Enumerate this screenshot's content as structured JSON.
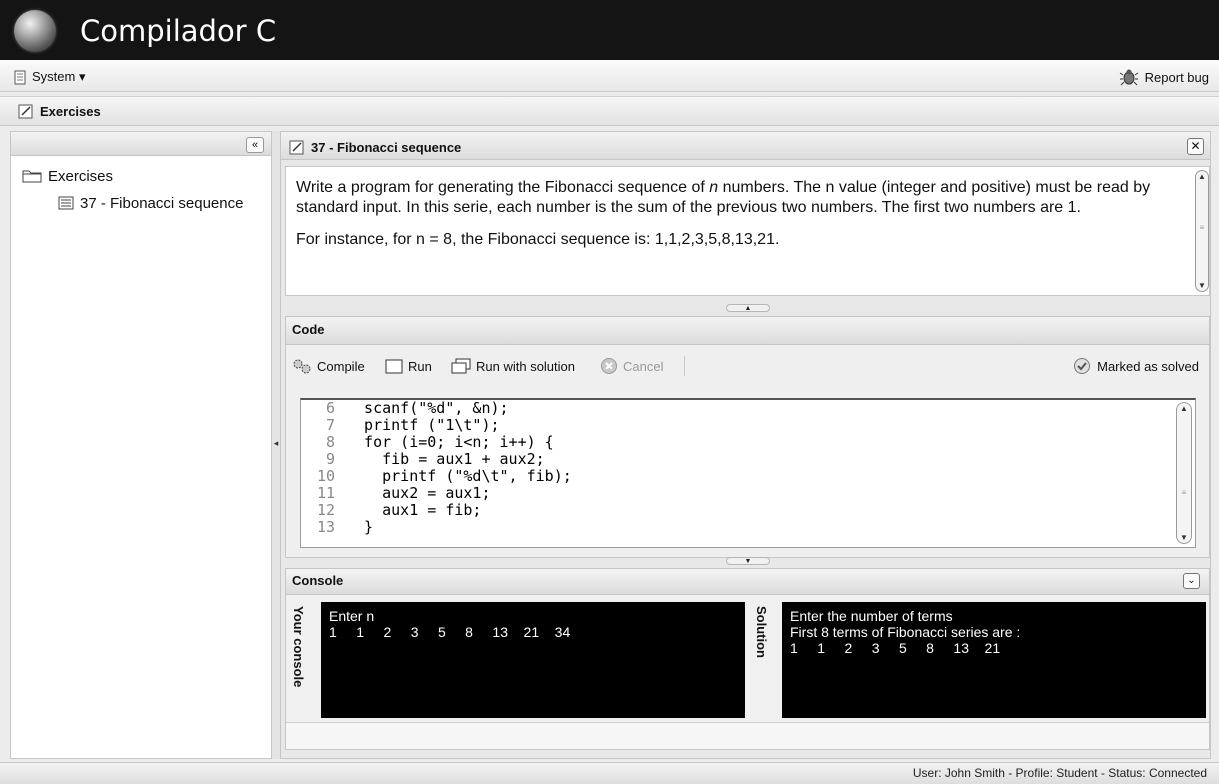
{
  "app": {
    "title": "Compilador C"
  },
  "menu": {
    "system_label": "System ▾",
    "report_bug_label": "Report bug"
  },
  "tabs": {
    "exercises_label": "Exercises"
  },
  "tree": {
    "root_label": "Exercises",
    "items": [
      {
        "label": "37 - Fibonacci sequence"
      }
    ]
  },
  "exercise": {
    "title": "37 - Fibonacci sequence",
    "description": {
      "line1_before": "Write a program for generating the Fibonacci sequence of ",
      "line1_italic": "n",
      "line1_after": " numbers. The n value (integer and positive) must be read by standard input. In this serie, each number is the sum of the previous two numbers. The first two numbers are 1.",
      "line2": "For instance, for n = 8, the Fibonacci sequence is: 1,1,2,3,5,8,13,21."
    }
  },
  "code": {
    "panel_title": "Code",
    "toolbar": {
      "compile": "Compile",
      "run": "Run",
      "run_with_solution": "Run with solution",
      "cancel": "Cancel",
      "marked_solved": "Marked as solved"
    },
    "lines": [
      {
        "num": "6",
        "text": "  scanf(\"%d\", &n);"
      },
      {
        "num": "7",
        "text": "  printf (\"1\\t\");"
      },
      {
        "num": "8",
        "text": "  for (i=0; i<n; i++) {"
      },
      {
        "num": "9",
        "text": "    fib = aux1 + aux2;"
      },
      {
        "num": "10",
        "text": "    printf (\"%d\\t\", fib);"
      },
      {
        "num": "11",
        "text": "    aux2 = aux1;"
      },
      {
        "num": "12",
        "text": "    aux1 = fib;"
      },
      {
        "num": "13",
        "text": "  }"
      }
    ]
  },
  "console": {
    "panel_title": "Console",
    "your_label": "Your console",
    "solution_label": "Solution",
    "your_output": "Enter n\n1     1     2     3     5     8     13    21    34",
    "solution_output": "Enter the number of terms\nFirst 8 terms of Fibonacci series are :\n1     1     2     3     5     8     13    21"
  },
  "status": {
    "text": "User: John Smith - Profile: Student - Status: Connected"
  }
}
